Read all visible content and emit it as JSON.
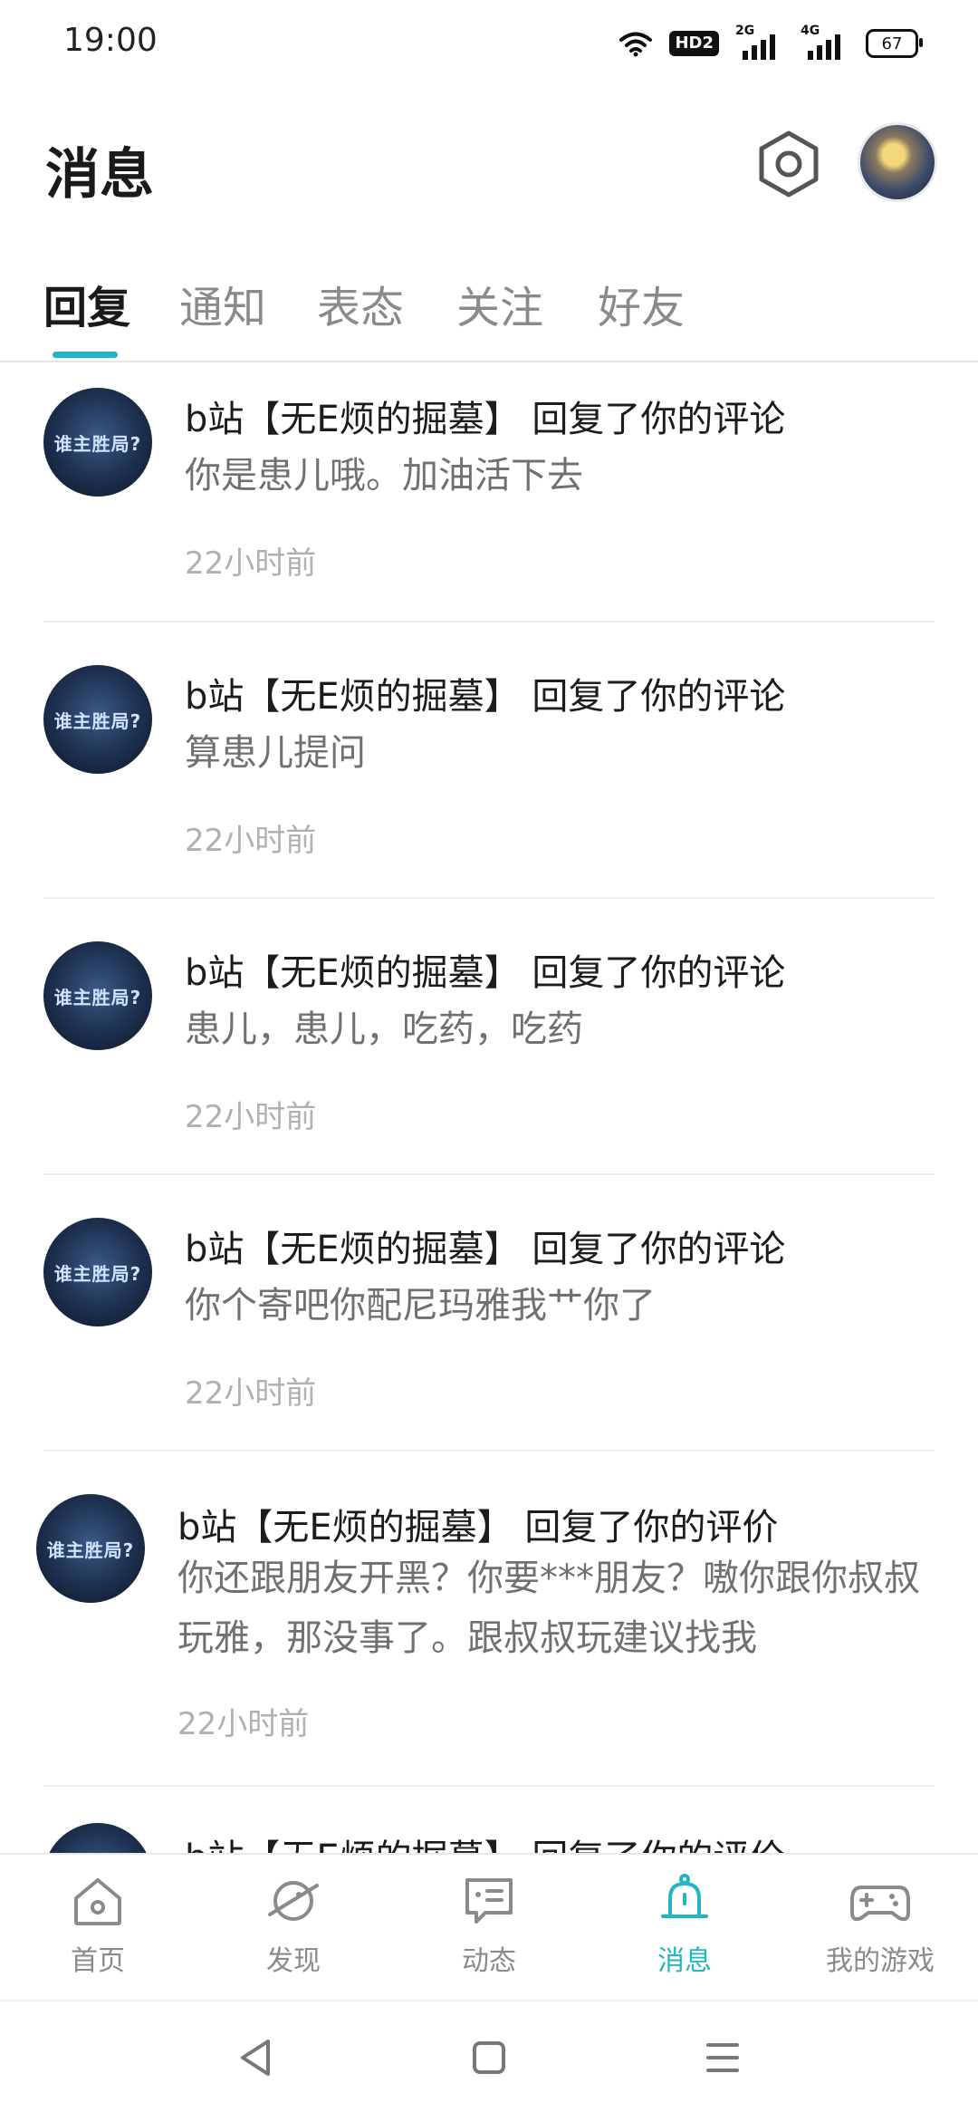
{
  "status_bar": {
    "time": "19:00",
    "hd_label": "HD2",
    "net1_label": "2G",
    "net2_label": "4G",
    "battery": "67"
  },
  "header": {
    "title": "消息"
  },
  "tabs": [
    {
      "label": "回复"
    },
    {
      "label": "通知"
    },
    {
      "label": "表态"
    },
    {
      "label": "关注"
    },
    {
      "label": "好友"
    }
  ],
  "items": [
    {
      "title": "b站【无E烦的掘墓】 回复了你的评论",
      "body": "你是患儿哦。加油活下去",
      "time": "22小时前"
    },
    {
      "title": "b站【无E烦的掘墓】 回复了你的评论",
      "body": "算患儿提问",
      "time": "22小时前"
    },
    {
      "title": "b站【无E烦的掘墓】 回复了你的评论",
      "body": "患儿，患儿，吃药，吃药",
      "time": "22小时前"
    },
    {
      "title": "b站【无E烦的掘墓】 回复了你的评论",
      "body": "你个寄吧你配尼玛雅我艹你了",
      "time": "22小时前"
    },
    {
      "title": "b站【无E烦的掘墓】 回复了你的评价",
      "body": "你还跟朋友开黑？你要***朋友？嗷你跟你叔叔玩雅，那没事了。跟叔叔玩建议找我",
      "time": "22小时前"
    },
    {
      "title": "b站【无E烦的掘墓】 回复了你的评价"
    }
  ],
  "avatar_logo": "谁主胜局?",
  "bottom_nav": [
    {
      "label": "首页",
      "icon": "home-icon"
    },
    {
      "label": "发现",
      "icon": "planet-icon"
    },
    {
      "label": "动态",
      "icon": "chat-icon"
    },
    {
      "label": "消息",
      "icon": "bell-icon"
    },
    {
      "label": "我的游戏",
      "icon": "gamepad-icon"
    }
  ],
  "colors": {
    "accent": "#23b5c3"
  }
}
